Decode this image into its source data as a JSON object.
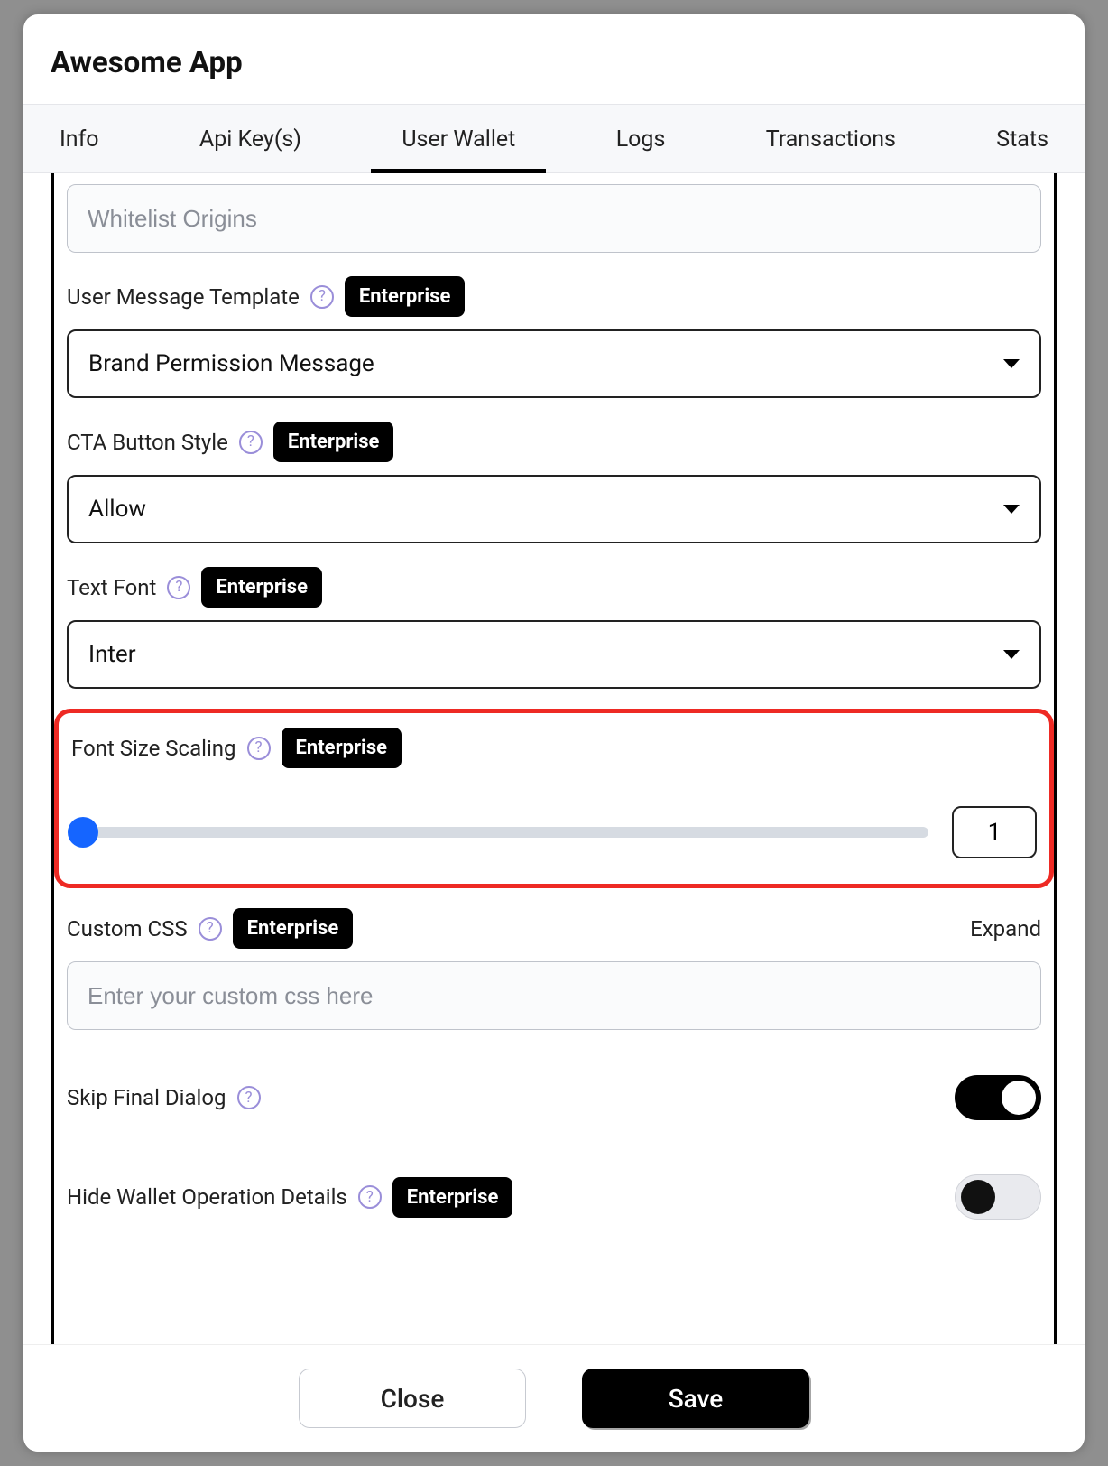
{
  "header": {
    "title": "Awesome App"
  },
  "tabs": {
    "items": [
      "Info",
      "Api Key(s)",
      "User Wallet",
      "Logs",
      "Transactions",
      "Stats"
    ],
    "activeIndex": 2
  },
  "badge": {
    "enterprise": "Enterprise"
  },
  "fields": {
    "whitelist_placeholder": "Whitelist Origins",
    "user_message_template": {
      "label": "User Message Template",
      "value": "Brand Permission Message"
    },
    "cta_button_style": {
      "label": "CTA Button Style",
      "value": "Allow"
    },
    "text_font": {
      "label": "Text Font",
      "value": "Inter"
    },
    "font_size_scaling": {
      "label": "Font Size Scaling",
      "value": "1"
    },
    "custom_css": {
      "label": "Custom CSS",
      "expand": "Expand",
      "placeholder": "Enter your custom css here"
    },
    "skip_final_dialog": {
      "label": "Skip Final Dialog",
      "on": true
    },
    "hide_wallet_op": {
      "label": "Hide Wallet Operation Details",
      "on": false
    }
  },
  "footer": {
    "close": "Close",
    "save": "Save"
  }
}
